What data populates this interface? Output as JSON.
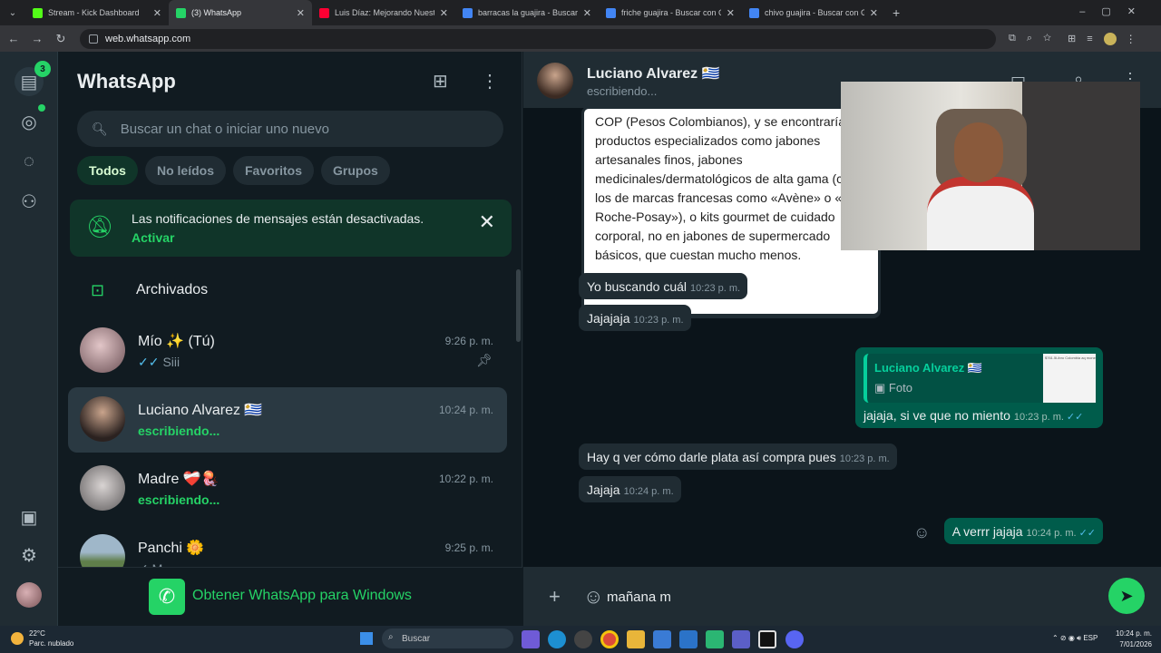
{
  "browser": {
    "tabs": [
      {
        "label": "Stream - Kick Dashboard",
        "color": "#53fc18",
        "active": false
      },
      {
        "label": "(3) WhatsApp",
        "color": "#25d366",
        "active": true
      },
      {
        "label": "Luis Díaz: Mejorando Nuestro I",
        "color": "#ff0033",
        "active": false
      },
      {
        "label": "barracas la guajira - Buscar con",
        "color": "#4285f4",
        "active": false
      },
      {
        "label": "friche guajira - Buscar con Goo",
        "color": "#4285f4",
        "active": false
      },
      {
        "label": "chivo guajira - Buscar con Goo",
        "color": "#4285f4",
        "active": false
      }
    ],
    "new_tab": "+",
    "url": "web.whatsapp.com"
  },
  "rail": {
    "chats_badge": "3"
  },
  "sidebar": {
    "title": "WhatsApp",
    "search_placeholder": "Buscar un chat o iniciar uno nuevo",
    "filters": [
      "Todos",
      "No leídos",
      "Favoritos",
      "Grupos"
    ],
    "notice_text": "Las notificaciones de mensajes están desactivadas.",
    "notice_link": "Activar",
    "archived_label": "Archivados",
    "chats": [
      {
        "name": "Mío ✨ (Tú)",
        "time": "9:26 p. m.",
        "sub": "Siii",
        "ticks": "✓✓",
        "pinned": true,
        "selected": false,
        "typing": false,
        "av": "radial-gradient(circle at 45% 40%, #e2c6c8, #6b5055)"
      },
      {
        "name": "Luciano Alvarez 🇺🇾",
        "time": "10:24 p. m.",
        "sub": "escribiendo...",
        "pinned": false,
        "selected": true,
        "typing": true,
        "av": "radial-gradient(circle at 50% 35%, #c9a48c, #2b2220 70%)"
      },
      {
        "name": "Madre ❤️‍🩹🪼",
        "time": "10:22 p. m.",
        "sub": "escribiendo...",
        "pinned": false,
        "selected": false,
        "typing": true,
        "av": "radial-gradient(circle at 50% 45%, #d9d4d3, #5d5a5b)"
      },
      {
        "name": "Panchi 🌼",
        "time": "9:25 p. m.",
        "sub": "✓ M",
        "pinned": false,
        "selected": false,
        "typing": false,
        "av": "linear-gradient(#9fb7c9 40%, #5f7e4a 60%)"
      }
    ],
    "get_app": "Obtener WhatsApp para Windows"
  },
  "conversation": {
    "name": "Luciano Alvarez 🇺🇾",
    "status": "escribiendo...",
    "image_text": [
      "COP (Pesos Colombianos), y se encontrarían",
      "productos especializados como jabones",
      "artesanales finos, jabones",
      "medicinales/dermatológicos de alta gama (c",
      "los de marcas francesas como «Avène» o «L",
      "Roche-Posay»), o kits gourmet de cuidado",
      "corporal, no en jabones de supermercado",
      "básicos, que cuestan mucho menos."
    ],
    "image_time": "10:23 p. m.",
    "messages": [
      {
        "dir": "in",
        "text": "Yo buscando cuál",
        "time": "10:23 p. m."
      },
      {
        "dir": "in",
        "text": "Jajajaja",
        "time": "10:23 p. m."
      },
      {
        "dir": "out",
        "text": "jajaja, si ve que no miento",
        "time": "10:23 p. m.",
        "quote_name": "Luciano Alvarez 🇺🇾",
        "quote_sub": "Foto"
      },
      {
        "dir": "in",
        "text": "Hay q ver cómo darle plata así compra pues",
        "time": "10:23 p. m."
      },
      {
        "dir": "in",
        "text": "Jajaja",
        "time": "10:24 p. m."
      },
      {
        "dir": "out",
        "text": "A verrr jajaja",
        "time": "10:24 p. m."
      }
    ],
    "composer_text": "mañana m",
    "quote_thumb_text": "$761.5Libro Colombia aq moneda local, $80.000 - Colombianos) - y se encuentran especializados como jabones finos, jabones dermatologicos de alta g francesa como «Avène»"
  },
  "taskbar": {
    "temp": "22°C",
    "weather": "Parc. nublado",
    "search": "Buscar",
    "lang": "ESP",
    "time": "10:24 p. m.",
    "date": "7/01/2026"
  }
}
